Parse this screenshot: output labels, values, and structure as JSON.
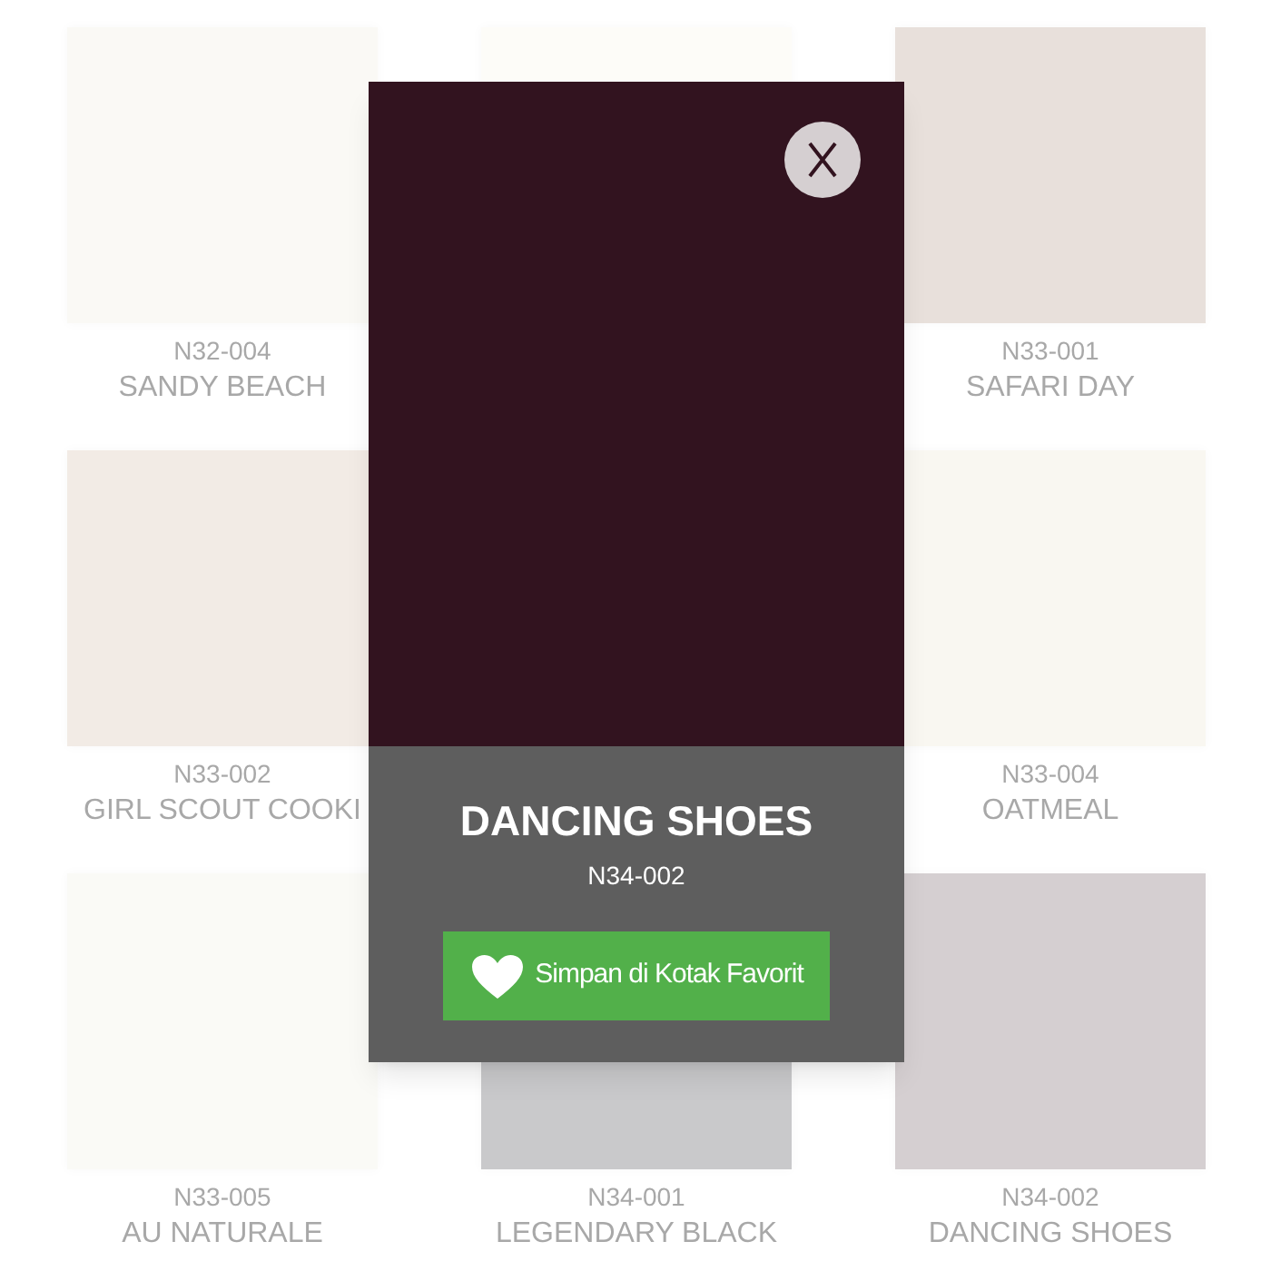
{
  "swatch_rows": [
    [
      {
        "color": "#faf9f5",
        "code": "N32-004",
        "name": "SANDY BEACH"
      },
      {
        "color": "#fdfcf8"
      },
      {
        "color": "#e8e0db",
        "code": "N33-001",
        "name": "SAFARI DAY"
      }
    ],
    [
      {
        "color": "#f2ebe5",
        "code": "N33-002",
        "name": "GIRL SCOUT COOKI"
      },
      {
        "color": "#f9f7f1",
        "code": "N33-004",
        "name": "OATMEAL"
      }
    ],
    [
      {
        "color": "#fafaf6",
        "code": "N33-005",
        "name": "AU NATURALE"
      },
      {
        "color": "#c9c9cb",
        "code": "N34-001",
        "name": "LEGENDARY BLACK"
      },
      {
        "color": "#d5cfd1",
        "code": "N34-002",
        "name": "DANCING SHOES"
      }
    ]
  ],
  "modal": {
    "color": "#32131f",
    "name": "DANCING SHOES",
    "code": "N34-002",
    "button": "Simpan di Kotak Favorit"
  }
}
